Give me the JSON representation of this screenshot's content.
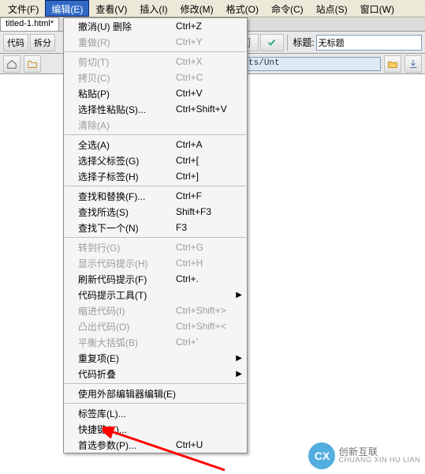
{
  "menubar": {
    "items": [
      "文件(F)",
      "编辑(E)",
      "查看(V)",
      "插入(I)",
      "修改(M)",
      "格式(O)",
      "命令(C)",
      "站点(S)",
      "窗口(W)"
    ],
    "activeIndex": 1
  },
  "tab": {
    "label": "titled-1.html*"
  },
  "toolbar1": {
    "btn1": "代码",
    "btn2": "拆分",
    "search_placeholder": "",
    "title_label": "标题:",
    "title_value": "无标题"
  },
  "toolbar2": {
    "path": "gqingyuan/My Documents/Unt"
  },
  "menu": {
    "groups": [
      [
        {
          "label": "撤消(U) 删除",
          "shortcut": "Ctrl+Z",
          "enabled": true,
          "sub": false
        },
        {
          "label": "重做(R)",
          "shortcut": "Ctrl+Y",
          "enabled": false,
          "sub": false
        }
      ],
      [
        {
          "label": "剪切(T)",
          "shortcut": "Ctrl+X",
          "enabled": false,
          "sub": false
        },
        {
          "label": "拷贝(C)",
          "shortcut": "Ctrl+C",
          "enabled": false,
          "sub": false
        },
        {
          "label": "粘贴(P)",
          "shortcut": "Ctrl+V",
          "enabled": true,
          "sub": false
        },
        {
          "label": "选择性粘贴(S)...",
          "shortcut": "Ctrl+Shift+V",
          "enabled": true,
          "sub": false
        },
        {
          "label": "清除(A)",
          "shortcut": "",
          "enabled": false,
          "sub": false
        }
      ],
      [
        {
          "label": "全选(A)",
          "shortcut": "Ctrl+A",
          "enabled": true,
          "sub": false
        },
        {
          "label": "选择父标签(G)",
          "shortcut": "Ctrl+[",
          "enabled": true,
          "sub": false
        },
        {
          "label": "选择子标签(H)",
          "shortcut": "Ctrl+]",
          "enabled": true,
          "sub": false
        }
      ],
      [
        {
          "label": "查找和替换(F)...",
          "shortcut": "Ctrl+F",
          "enabled": true,
          "sub": false
        },
        {
          "label": "查找所选(S)",
          "shortcut": "Shift+F3",
          "enabled": true,
          "sub": false
        },
        {
          "label": "查找下一个(N)",
          "shortcut": "F3",
          "enabled": true,
          "sub": false
        }
      ],
      [
        {
          "label": "转到行(G)",
          "shortcut": "Ctrl+G",
          "enabled": false,
          "sub": false
        },
        {
          "label": "显示代码提示(H)",
          "shortcut": "Ctrl+H",
          "enabled": false,
          "sub": false
        },
        {
          "label": "刷新代码提示(F)",
          "shortcut": "Ctrl+.",
          "enabled": true,
          "sub": false
        },
        {
          "label": "代码提示工具(T)",
          "shortcut": "",
          "enabled": true,
          "sub": true
        },
        {
          "label": "缩进代码(I)",
          "shortcut": "Ctrl+Shift+>",
          "enabled": false,
          "sub": false
        },
        {
          "label": "凸出代码(O)",
          "shortcut": "Ctrl+Shift+<",
          "enabled": false,
          "sub": false
        },
        {
          "label": "平衡大括弧(B)",
          "shortcut": "Ctrl+'",
          "enabled": false,
          "sub": false
        },
        {
          "label": "重复项(E)",
          "shortcut": "",
          "enabled": true,
          "sub": true
        },
        {
          "label": "代码折叠",
          "shortcut": "",
          "enabled": true,
          "sub": true
        }
      ],
      [
        {
          "label": "使用外部编辑器编辑(E)",
          "shortcut": "",
          "enabled": true,
          "sub": false
        }
      ],
      [
        {
          "label": "标签库(L)...",
          "shortcut": "",
          "enabled": true,
          "sub": false
        },
        {
          "label": "快捷键(Y)...",
          "shortcut": "",
          "enabled": true,
          "sub": false
        },
        {
          "label": "首选参数(P)...",
          "shortcut": "Ctrl+U",
          "enabled": true,
          "sub": false
        }
      ]
    ]
  },
  "watermark": {
    "brand": "创新互联",
    "sub": "CHUANG XIN HU LIAN"
  }
}
